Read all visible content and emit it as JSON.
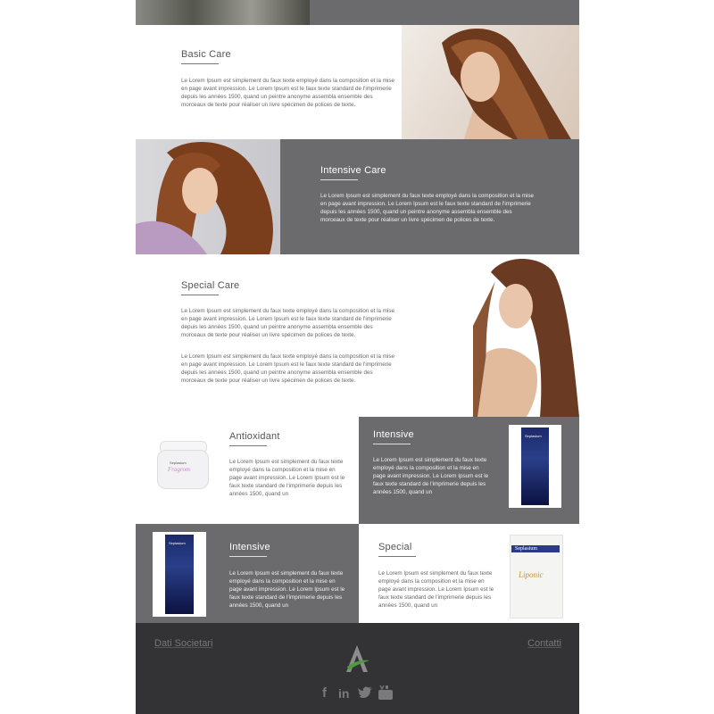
{
  "sections": {
    "basic": {
      "title": "Basic Care",
      "text": "Le Lorem Ipsum est simplement du faux texte employé dans la composition et la mise en page avant impression. Le Lorem Ipsum est le faux texte standard de l'imprimerie depuis les années 1500, quand un peintre anonyme assembla ensemble des morceaux de texte pour réaliser un livre spécimen de polices de texte."
    },
    "intensive_care": {
      "title": "Intensive Care",
      "text": "Le Lorem Ipsum est simplement du faux texte employé dans la composition et la mise en page avant impression. Le Lorem Ipsum est le faux texte standard de l'imprimerie depuis les années 1500, quand un peintre anonyme assembla ensemble des morceaux de texte pour réaliser un livre spécimen de polices de texte."
    },
    "special_care": {
      "title": "Special Care",
      "text1": "Le Lorem Ipsum est simplement du faux texte employé dans la composition et la mise en page avant impression. Le Lorem Ipsum est le faux texte standard de l'imprimerie depuis les années 1500, quand un peintre anonyme assembla ensemble des morceaux de texte pour réaliser un livre spécimen de polices de texte.",
      "text2": "Le Lorem Ipsum est simplement du faux texte employé dans la composition et la mise en page avant impression. Le Lorem Ipsum est le faux texte standard de l'imprimerie depuis les années 1500, quand un peintre anonyme assembla ensemble des morceaux de texte pour réaliser un livre spécimen de polices de texte."
    }
  },
  "products": {
    "antioxidant": {
      "title": "Antioxidant",
      "text": "Le Lorem Ipsum est simplement du faux texte employé dans la composition et la mise en page avant impression. Le Lorem Ipsum est le faux texte standard de l'imprimerie depuis les années 1500, quand un",
      "jar_brand": "Seplasium",
      "jar_name": "Fragrom"
    },
    "intensive_top": {
      "title": "Intensive",
      "text": "Le Lorem Ipsum est simplement du faux texte employé dans la composition et la mise en page avant impression. Le Lorem Ipsum est le faux texte standard de l'imprimerie depuis les années 1500, quand un",
      "box_brand": "Seplasium"
    },
    "intensive_bottom": {
      "title": "Intensive",
      "text": "Le Lorem Ipsum est simplement du faux texte employé dans la composition et la mise en page avant impression. Le Lorem Ipsum est le faux texte standard de l'imprimerie depuis les années 1500, quand un",
      "box_brand": "Seplasium"
    },
    "special": {
      "title": "Special",
      "text": "Le Lorem Ipsum est simplement du faux texte employé dans la composition et la mise en page avant impression. Le Lorem Ipsum est le faux texte standard de l'imprimerie depuis les années 1500, quand un",
      "jar_brand": "Seplasium",
      "jar_name": "Liponic"
    }
  },
  "footer": {
    "left_link": "Dati Societari",
    "right_link": "Contatti",
    "social": {
      "facebook": "f",
      "linkedin": "in",
      "twitter": "🐦",
      "youtube": "▶"
    }
  },
  "colors": {
    "grey_panel": "#6b6b6d",
    "footer_bg": "#333335",
    "logo_green": "#4f9a3c"
  },
  "icons": [
    "facebook-icon",
    "linkedin-icon",
    "twitter-icon",
    "youtube-icon",
    "brand-logo-icon"
  ]
}
